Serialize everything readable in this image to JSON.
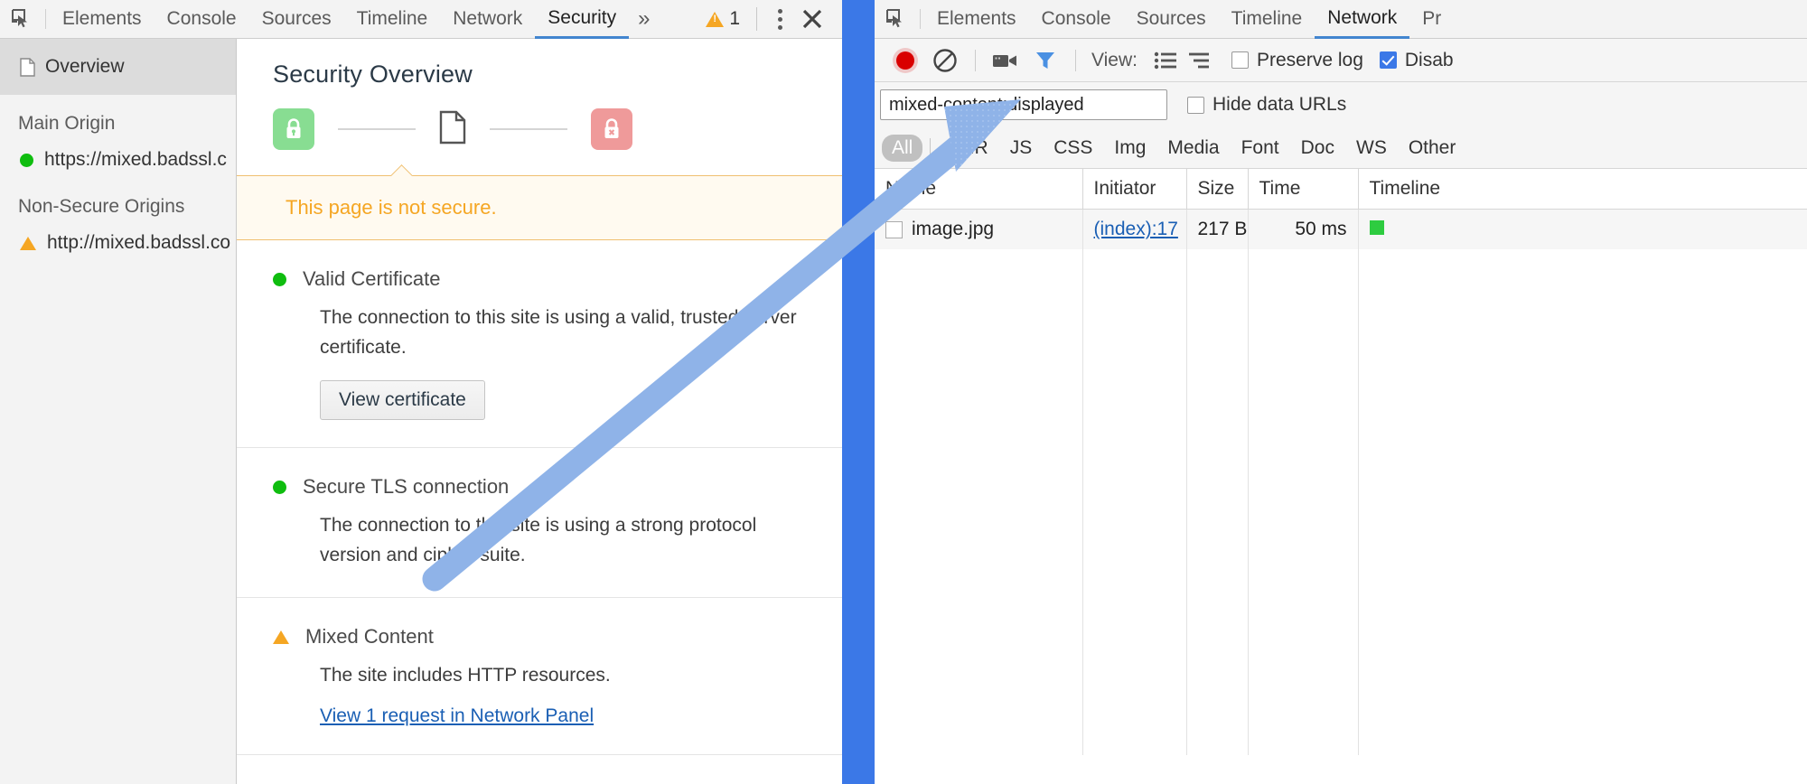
{
  "security_panel": {
    "toolbar": {
      "inspect_icon": "inspect-cursor-icon",
      "tabs": [
        {
          "label": "Elements",
          "selected": false
        },
        {
          "label": "Console",
          "selected": false
        },
        {
          "label": "Sources",
          "selected": false
        },
        {
          "label": "Timeline",
          "selected": false
        },
        {
          "label": "Network",
          "selected": false
        },
        {
          "label": "Security",
          "selected": true
        }
      ],
      "more_tabs": "»",
      "warning_count": "1",
      "warning_icon": "warning-triangle-icon",
      "menu_icon": "kebab-menu-icon",
      "close_icon": "close-icon"
    },
    "sidebar": {
      "overview_label": "Overview",
      "overview_icon": "document-icon",
      "main_origin_group": "Main Origin",
      "main_origin": "https://mixed.badssl.c",
      "non_secure_group": "Non-Secure Origins",
      "non_secure_origin": "http://mixed.badssl.co"
    },
    "main": {
      "title": "Security Overview",
      "summary_icons": [
        "lock-green-icon",
        "document-icon",
        "lock-broken-red-icon"
      ],
      "banner_text": "This page is not secure.",
      "sections": [
        {
          "status": "green",
          "title": "Valid Certificate",
          "description": "The connection to this site is using a valid, trusted server certificate.",
          "button": "View certificate",
          "link": ""
        },
        {
          "status": "green",
          "title": "Secure TLS connection",
          "description": "The connection to this site is using a strong protocol version and cipher suite.",
          "button": "",
          "link": ""
        },
        {
          "status": "warning",
          "title": "Mixed Content",
          "description": "The site includes HTTP resources.",
          "button": "",
          "link": "View 1 request in Network Panel"
        }
      ]
    }
  },
  "network_panel": {
    "toolbar": {
      "inspect_icon": "inspect-cursor-icon",
      "tabs": [
        {
          "label": "Elements",
          "selected": false
        },
        {
          "label": "Console",
          "selected": false
        },
        {
          "label": "Sources",
          "selected": false
        },
        {
          "label": "Timeline",
          "selected": false
        },
        {
          "label": "Network",
          "selected": true
        },
        {
          "label": "Pr",
          "selected": false
        }
      ]
    },
    "controls": {
      "record_icon": "record-circle-icon",
      "clear_icon": "clear-no-entry-icon",
      "capture_screenshots_icon": "camera-icon",
      "filter_icon": "funnel-icon",
      "view_label": "View:",
      "view_list_icon": "list-view-icon",
      "view_tree_icon": "tree-view-icon",
      "preserve_log_label": "Preserve log",
      "preserve_log_checked": false,
      "disable_cache_label": "Disab",
      "disable_cache_checked": true
    },
    "filter": {
      "value": "mixed-content:displayed",
      "placeholder": "Filter",
      "hide_data_urls_label": "Hide data URLs",
      "hide_data_urls_checked": false,
      "types": [
        {
          "label": "All",
          "selected": true
        },
        {
          "label": "XHR",
          "selected": false
        },
        {
          "label": "JS",
          "selected": false
        },
        {
          "label": "CSS",
          "selected": false
        },
        {
          "label": "Img",
          "selected": false
        },
        {
          "label": "Media",
          "selected": false
        },
        {
          "label": "Font",
          "selected": false
        },
        {
          "label": "Doc",
          "selected": false
        },
        {
          "label": "WS",
          "selected": false
        },
        {
          "label": "Other",
          "selected": false
        }
      ]
    },
    "table": {
      "columns": [
        "Name",
        "Initiator",
        "Size",
        "Time",
        "Timeline"
      ],
      "rows": [
        {
          "name": "image.jpg",
          "initiator": "(index):17",
          "size": "217 B",
          "time": "50 ms",
          "timeline": "bar"
        }
      ]
    }
  },
  "annotation": {
    "arrow_icon": "blue-arrow-icon",
    "arrow_color": "#8fb3e8"
  },
  "colors": {
    "accent_blue": "#3b78e7",
    "warning_orange": "#f5a623",
    "success_green": "#0fbd0f",
    "error_red": "#d90000",
    "link_blue": "#1a5fb4"
  }
}
